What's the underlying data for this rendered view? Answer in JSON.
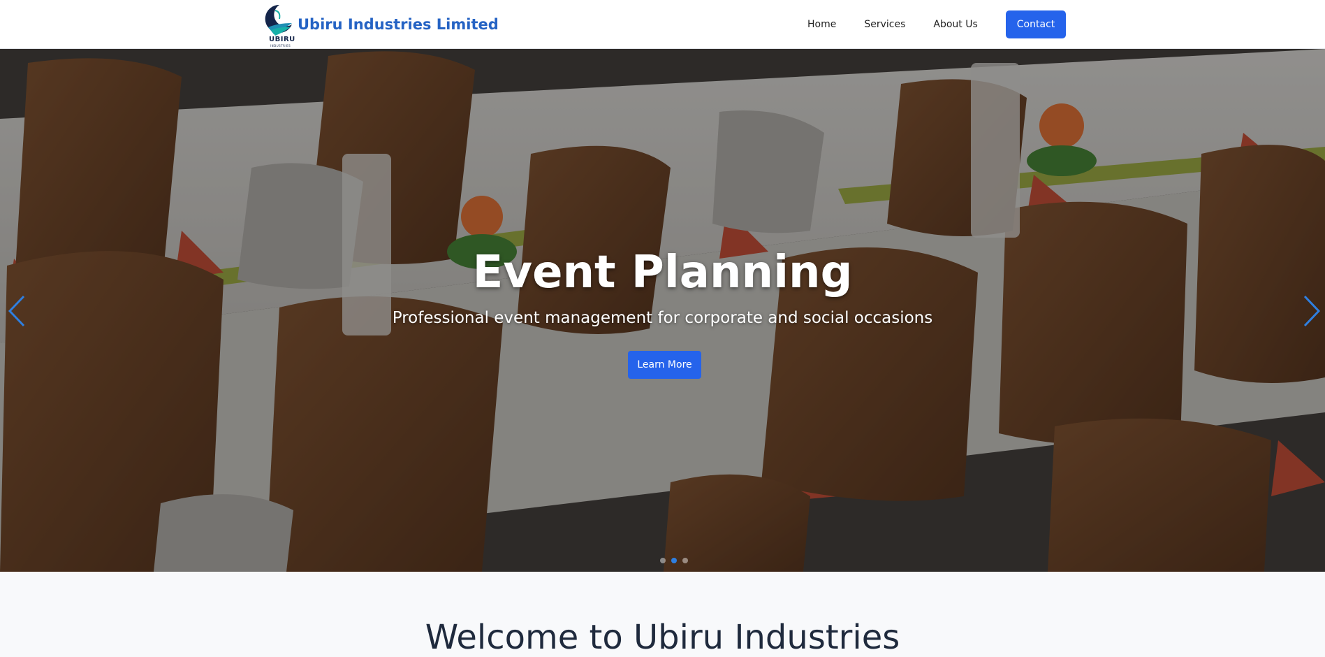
{
  "brand": {
    "name": "Ubiru Industries Limited",
    "logo_text": "UBIRU",
    "logo_subtext": "INDUSTRIES"
  },
  "nav": {
    "items": [
      {
        "label": "Home"
      },
      {
        "label": "Services"
      },
      {
        "label": "About Us"
      }
    ],
    "cta_label": "Contact"
  },
  "hero": {
    "title": "Event Planning",
    "subtitle": "Professional event management for corporate and social occasions",
    "button_label": "Learn More",
    "prev_icon": "chevron-left-icon",
    "next_icon": "chevron-right-icon",
    "slide_count": 3,
    "active_slide": 1
  },
  "welcome": {
    "heading": "Welcome to Ubiru Industries"
  },
  "colors": {
    "brand_blue": "#2563c4",
    "button_blue": "#2563eb",
    "navy": "#14254a",
    "heading": "#1f2a3d"
  }
}
